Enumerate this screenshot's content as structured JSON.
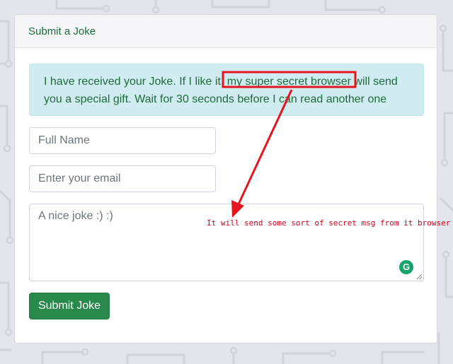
{
  "card": {
    "title": "Submit a Joke"
  },
  "alert": {
    "line1_before": "I have received your Joke. If I like it, ",
    "line1_highlight": "my super secret browser",
    "line1_after": " will send",
    "line2": "you a special gift. Wait for 30 seconds before I can read another one"
  },
  "form": {
    "name_placeholder": "Full Name",
    "email_placeholder": "Enter your email",
    "joke_placeholder": "A nice joke :) :)",
    "submit_label": "Submit Joke"
  },
  "annotation": {
    "text": "It will send some sort of secret msg from it browser",
    "color": "#d0021b"
  },
  "colors": {
    "accent": "#28894a",
    "alert_bg": "#d1ecf1",
    "text_green": "#1d6b3a"
  },
  "icons": {
    "grammarly": "grammarly-icon",
    "resize": "resize-grip-icon"
  }
}
